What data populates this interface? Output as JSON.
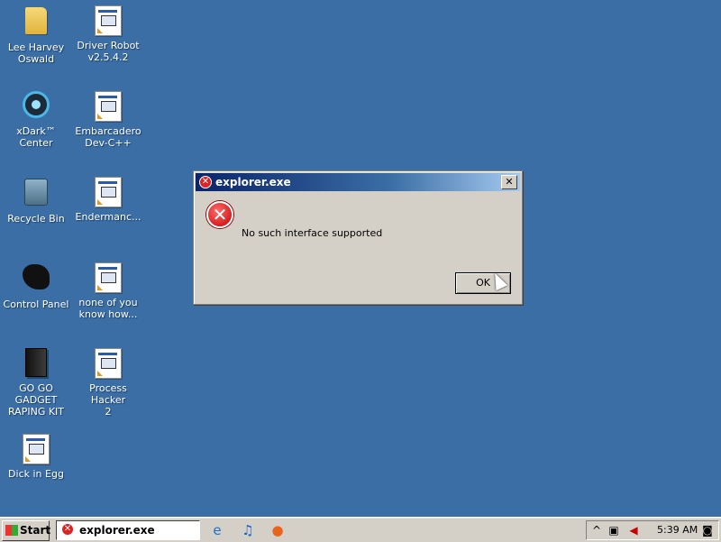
{
  "desktop": {
    "icons": [
      {
        "label_line1": "Lee Harvey",
        "label_line2": "Oswald",
        "icon": "folder-icon"
      },
      {
        "label_line1": "Driver Robot",
        "label_line2": "v2.5.4.2",
        "icon": "application-icon"
      },
      {
        "label_line1": "xDark™ Center",
        "label_line2": "",
        "icon": "xdark-center-icon"
      },
      {
        "label_line1": "Embarcadero",
        "label_line2": "Dev-C++",
        "icon": "application-icon"
      },
      {
        "label_line1": "Recycle Bin",
        "label_line2": "",
        "icon": "recycle-bin-icon"
      },
      {
        "label_line1": "Endermanc...",
        "label_line2": "",
        "icon": "application-icon"
      },
      {
        "label_line1": "Control Panel",
        "label_line2": "",
        "icon": "control-panel-icon"
      },
      {
        "label_line1": "none of you",
        "label_line2": "know how...",
        "icon": "application-icon"
      },
      {
        "label_line1": "GO GO GADGET",
        "label_line2": "RAPING KIT",
        "icon": "kit-icon"
      },
      {
        "label_line1": "Process Hacker",
        "label_line2": "2",
        "icon": "application-icon"
      },
      {
        "label_line1": "Dick in Egg",
        "label_line2": "",
        "icon": "application-icon"
      }
    ]
  },
  "dialog": {
    "title": "explorer.exe",
    "close_glyph": "✕",
    "message": "No such interface supported",
    "ok_label": "OK",
    "icon": "error-icon"
  },
  "taskbar": {
    "start_label": "Start",
    "active_task": "explorer.exe",
    "quick_launch": [
      "internet-explorer-icon",
      "media-player-icon",
      "firefox-icon"
    ],
    "tray_icons": [
      "show-hidden-icons-icon",
      "network-icon",
      "volume-muted-icon",
      "tray-app-icon"
    ],
    "clock": "5:39 AM"
  },
  "colors": {
    "desktop": "#3a6ea5",
    "titlebar_start": "#0a246a",
    "titlebar_end": "#a6caf0",
    "error_red": "#c40000"
  }
}
